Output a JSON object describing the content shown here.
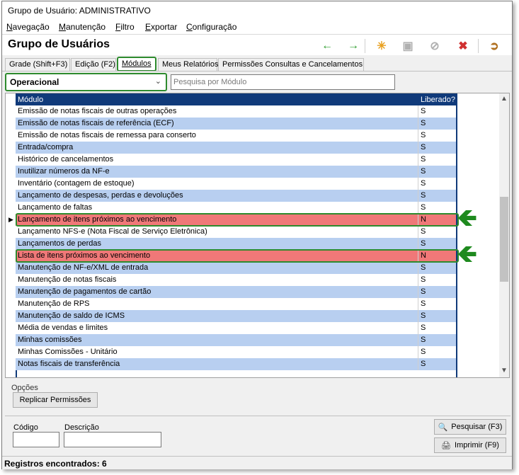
{
  "window": {
    "title": "Grupo de Usuário: ADMINISTRATIVO"
  },
  "menu": {
    "items": [
      "Navegação",
      "Manutenção",
      "Filtro",
      "Exportar",
      "Configuração"
    ]
  },
  "header": {
    "title": "Grupo de Usuários"
  },
  "toolbar": {
    "icons": [
      "arrow-left-icon",
      "arrow-right-icon",
      "new-icon",
      "save-icon",
      "cancel-icon",
      "delete-icon",
      "exit-icon"
    ]
  },
  "tabs": [
    {
      "label": "Grade (Shift+F3)"
    },
    {
      "label": "Edição (F2)"
    },
    {
      "label": "Módulos"
    },
    {
      "label": "Meus Relatórios"
    },
    {
      "label": "Permissões Consultas e Cancelamentos"
    }
  ],
  "filter": {
    "combo_value": "Operacional",
    "search_placeholder": "Pesquisa por Módulo"
  },
  "grid": {
    "columns": [
      "Módulo",
      "Liberado?"
    ],
    "rows": [
      {
        "modulo": "Emissão de notas fiscais de outras operações",
        "liberado": "S"
      },
      {
        "modulo": "Emissão de notas fiscais de referência (ECF)",
        "liberado": "S"
      },
      {
        "modulo": "Emissão de notas fiscais de remessa para conserto",
        "liberado": "S"
      },
      {
        "modulo": "Entrada/compra",
        "liberado": "S"
      },
      {
        "modulo": "Histórico de cancelamentos",
        "liberado": "S"
      },
      {
        "modulo": "Inutilizar números da NF-e",
        "liberado": "S"
      },
      {
        "modulo": "Inventário (contagem de estoque)",
        "liberado": "S"
      },
      {
        "modulo": "Lançamento de despesas, perdas e devoluções",
        "liberado": "S"
      },
      {
        "modulo": "Lançamento de faltas",
        "liberado": "S"
      },
      {
        "modulo": "Lançamento de itens próximos ao vencimento",
        "liberado": "N"
      },
      {
        "modulo": "Lançamento NFS-e (Nota Fiscal de Serviço Eletrônica)",
        "liberado": "S"
      },
      {
        "modulo": "Lançamentos de perdas",
        "liberado": "S"
      },
      {
        "modulo": "Lista de itens próximos ao vencimento",
        "liberado": "N"
      },
      {
        "modulo": "Manutenção de NF-e/XML de entrada",
        "liberado": "S"
      },
      {
        "modulo": "Manutenção de notas fiscais",
        "liberado": "S"
      },
      {
        "modulo": "Manutenção de pagamentos de cartão",
        "liberado": "S"
      },
      {
        "modulo": "Manutenção de RPS",
        "liberado": "S"
      },
      {
        "modulo": "Manutenção de saldo de ICMS",
        "liberado": "S"
      },
      {
        "modulo": "Média de vendas e limites",
        "liberado": "S"
      },
      {
        "modulo": "Minhas comissões",
        "liberado": "S"
      },
      {
        "modulo": "Minhas Comissões - Unitário",
        "liberado": "S"
      },
      {
        "modulo": "Notas fiscais de transferência",
        "liberado": "S"
      }
    ]
  },
  "options": {
    "label": "Opções",
    "replicate_button": "Replicar Permissões"
  },
  "search_panel": {
    "codigo_label": "Código",
    "descricao_label": "Descrição",
    "search_button": "Pesquisar (F3)",
    "print_button": "Imprimir (F9)"
  },
  "status": {
    "text": "Registros encontrados: 6"
  },
  "colors": {
    "header_blue": "#103a7a",
    "alt_row": "#b8cff0",
    "highlight_row": "#f07878",
    "annotation_green": "#2e8b2e"
  }
}
